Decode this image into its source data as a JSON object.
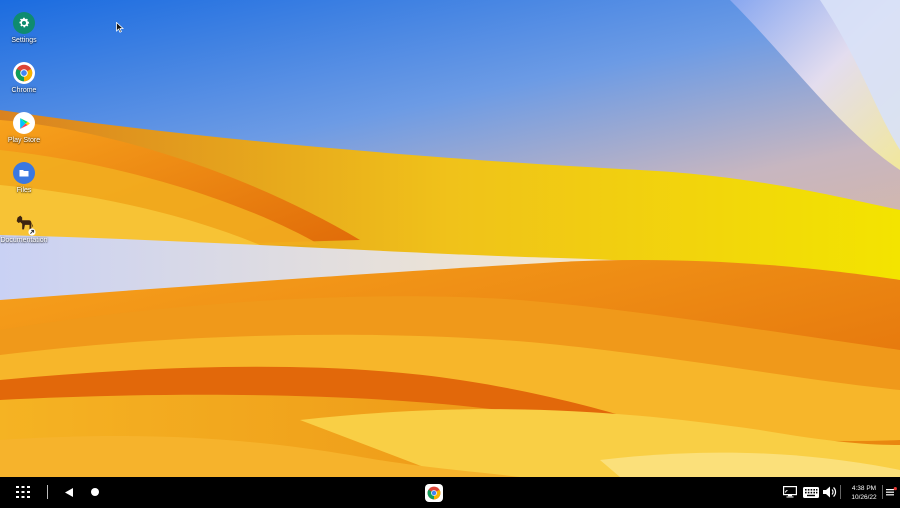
{
  "desktop": {
    "icons": [
      {
        "label": "Settings",
        "icon": "gear-icon",
        "color": "#0f8b70"
      },
      {
        "label": "Chrome",
        "icon": "chrome-icon",
        "color": "#ffffff"
      },
      {
        "label": "Play Store",
        "icon": "play-store-icon",
        "color": "#ffffff"
      },
      {
        "label": "Files",
        "icon": "folder-icon",
        "color": "#2f6fd8"
      },
      {
        "label": "Documentation",
        "icon": "horse-icon",
        "color": "#5a3a1a"
      }
    ]
  },
  "taskbar": {
    "launcher_icon": "app-grid-icon",
    "back_icon": "back-triangle-icon",
    "home_icon": "home-circle-icon",
    "pinned_app_icon": "chrome-icon",
    "tray_icons": [
      "screen-cast-icon",
      "keyboard-icon",
      "volume-icon",
      "notifications-icon"
    ],
    "time": "4:38 PM",
    "date": "10/26/22"
  },
  "colors": {
    "taskbar_bg": "#000000",
    "sky_blue": "#1d6fe0",
    "orange": "#ef8a0e",
    "yellow": "#f4c318"
  }
}
